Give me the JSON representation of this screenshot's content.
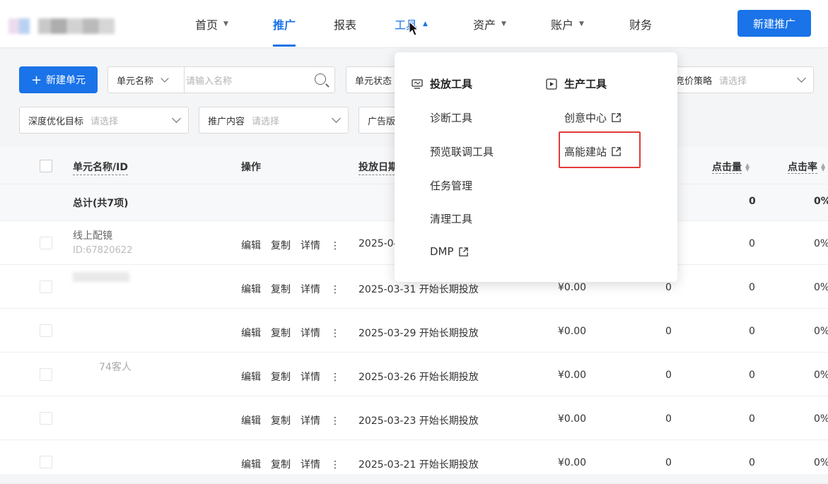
{
  "header": {
    "nav": [
      {
        "label": "首页",
        "has_caret": true
      },
      {
        "label": "推广",
        "has_caret": false
      },
      {
        "label": "报表",
        "has_caret": false
      },
      {
        "label": "工具",
        "has_caret": true
      },
      {
        "label": "资产",
        "has_caret": true
      },
      {
        "label": "账户",
        "has_caret": true
      },
      {
        "label": "财务",
        "has_caret": false
      }
    ],
    "active_nav": "推广",
    "hover_nav": "工具",
    "new_promo_button": "新建推广"
  },
  "filters": {
    "new_unit_button": "新建单元",
    "unit_name_select": "单元名称",
    "unit_name_placeholder": "请输入名称",
    "unit_status": "单元状态",
    "bid_strategy_label": "竞价策略",
    "bid_strategy_placeholder": "请选择",
    "deep_opt_label": "深度优化目标",
    "deep_opt_placeholder": "请选择",
    "promo_content_label": "推广内容",
    "promo_content_placeholder": "请选择",
    "ad_version_label": "广告版"
  },
  "table": {
    "headers": {
      "name": "单元名称/ID",
      "op": "操作",
      "date": "投放日期",
      "clicks": "点击量",
      "ctr": "点击率"
    },
    "total": {
      "label": "总计(共7项)",
      "clicks": "0",
      "ctr": "0%"
    },
    "rows": [
      {
        "name": "线上配镜",
        "id": "ID:67820622",
        "date": "2025-04",
        "cost": "",
        "col": "",
        "clicks": "0",
        "ctr": "0%"
      },
      {
        "name": "",
        "id": "",
        "date": "2025-03-31 开始长期投放",
        "cost": "¥0.00",
        "col": "0",
        "clicks": "0",
        "ctr": "0%"
      },
      {
        "name": "",
        "id": "",
        "date": "2025-03-29 开始长期投放",
        "cost": "¥0.00",
        "col": "0",
        "clicks": "0",
        "ctr": "0%"
      },
      {
        "name": "74客人",
        "id": "",
        "date": "2025-03-26 开始长期投放",
        "cost": "¥0.00",
        "col": "0",
        "clicks": "0",
        "ctr": "0%"
      },
      {
        "name": "",
        "id": "",
        "date": "2025-03-23 开始长期投放",
        "cost": "¥0.00",
        "col": "0",
        "clicks": "0",
        "ctr": "0%"
      },
      {
        "name": "",
        "id": "",
        "date": "2025-03-21 开始长期投放",
        "cost": "¥0.00",
        "col": "0",
        "clicks": "0",
        "ctr": "0%"
      }
    ],
    "ops": [
      "编辑",
      "复制",
      "详情"
    ]
  },
  "dropdown": {
    "left_title": "投放工具",
    "left_items": [
      "诊断工具",
      "预览联调工具",
      "任务管理",
      "清理工具",
      "DMP"
    ],
    "right_title": "生产工具",
    "right_items": [
      "创意中心",
      "高能建站"
    ]
  },
  "colors": {
    "accent": "#1a73e8",
    "highlight": "#e03c3c"
  }
}
